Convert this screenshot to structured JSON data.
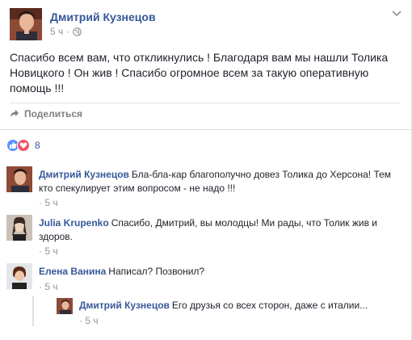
{
  "post": {
    "author": "Дмитрий Кузнецов",
    "time": "5 ч",
    "privacy_icon": "globe-icon",
    "text": "Спасибо всем вам, что откликнулись ! Благодаря вам мы нашли Толика Новицкого ! Он жив ! Спасибо огромное всем за такую оперативную помощь !!!",
    "share_label": "Поделиться"
  },
  "reactions": {
    "count": "8",
    "types": [
      "like-icon",
      "love-icon"
    ],
    "colors": {
      "like": "#5890ff",
      "love": "#f25268"
    }
  },
  "comments": [
    {
      "author": "Дмитрий Кузнецов",
      "text": "Бла-бла-кар благополучно довез Толика до Херсона! Тем кто спекулирует этим вопросом - не надо !!!",
      "time": "· 5 ч"
    },
    {
      "author": "Julia Krupenko",
      "text": "Спасибо, Дмитрий, вы молодцы! Ми рады, что Толик жив и здоров.",
      "time": "· 5 ч"
    },
    {
      "author": "Елена Ванина",
      "text": "Написал? Позвонил?",
      "time": "· 5 ч"
    }
  ],
  "reply": {
    "author": "Дмитрий Кузнецов",
    "text": "Его друзья со всех сторон, даже с италии...",
    "time": "· 5 ч"
  },
  "theme": {
    "link_color": "#365899",
    "meta_color": "#90949c"
  }
}
